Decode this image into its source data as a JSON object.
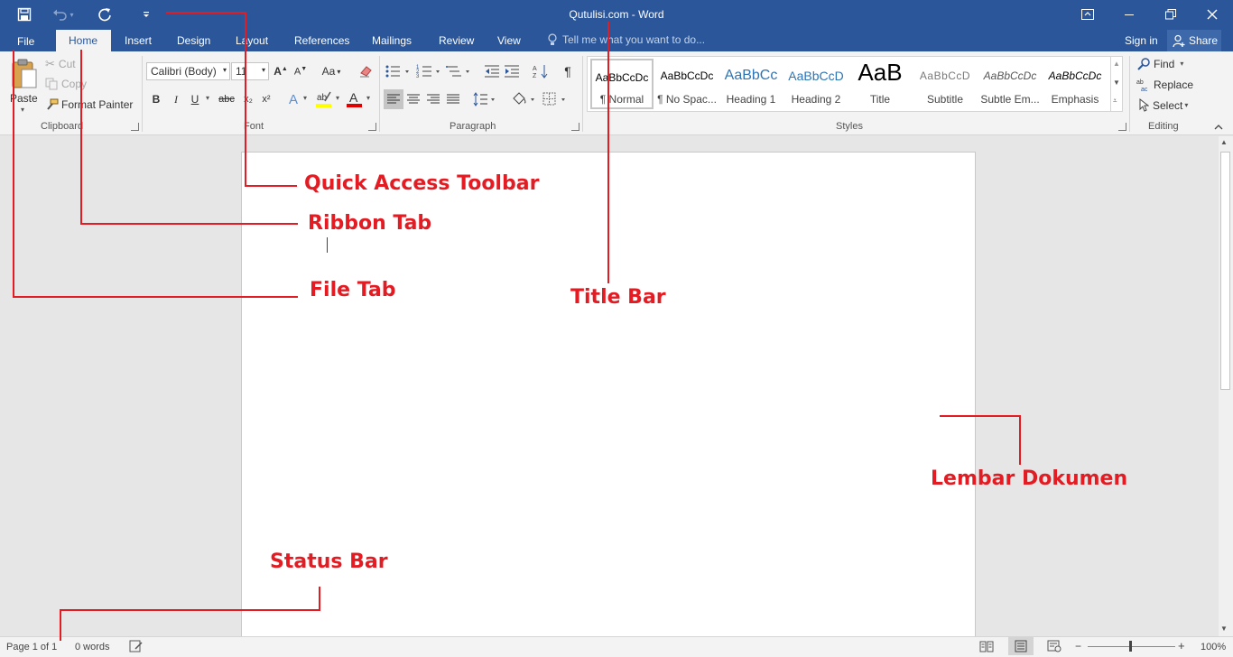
{
  "window": {
    "title": "Qutulisi.com - Word"
  },
  "quick_access": {
    "icons": [
      "save-icon",
      "undo-icon",
      "redo-icon",
      "customize-qat-icon"
    ]
  },
  "tabs": [
    {
      "label": "File"
    },
    {
      "label": "Home",
      "active": true
    },
    {
      "label": "Insert"
    },
    {
      "label": "Design"
    },
    {
      "label": "Layout"
    },
    {
      "label": "References"
    },
    {
      "label": "Mailings"
    },
    {
      "label": "Review"
    },
    {
      "label": "View"
    }
  ],
  "tell_me": {
    "placeholder": "Tell me what you want to do..."
  },
  "account": {
    "sign_in": "Sign in",
    "share": "Share"
  },
  "clipboard": {
    "label": "Clipboard",
    "paste": "Paste",
    "cut": "Cut",
    "copy": "Copy",
    "format_painter": "Format Painter"
  },
  "font": {
    "label": "Font",
    "family": "Calibri (Body)",
    "size": "11",
    "bold": "B",
    "italic": "I",
    "underline": "U",
    "strikethrough": "abc",
    "subscript": "x₂",
    "superscript": "x²",
    "change_case": "Aa"
  },
  "paragraph": {
    "label": "Paragraph"
  },
  "styles": {
    "label": "Styles",
    "items": [
      {
        "sample": "AaBbCcDc",
        "name": "¶ Normal"
      },
      {
        "sample": "AaBbCcDc",
        "name": "¶ No Spac..."
      },
      {
        "sample": "AaBbCc",
        "name": "Heading 1"
      },
      {
        "sample": "AaBbCcD",
        "name": "Heading 2"
      },
      {
        "sample": "AaB",
        "name": "Title"
      },
      {
        "sample": "AaBbCcD",
        "name": "Subtitle"
      },
      {
        "sample": "AaBbCcDc",
        "name": "Subtle Em..."
      },
      {
        "sample": "AaBbCcDc",
        "name": "Emphasis"
      }
    ]
  },
  "editing": {
    "label": "Editing",
    "find": "Find",
    "replace": "Replace",
    "select": "Select"
  },
  "status": {
    "page": "Page 1 of 1",
    "words": "0 words",
    "zoom": "100%"
  },
  "annotations": {
    "quick_access": "Quick Access Toolbar",
    "ribbon_tab": "Ribbon Tab",
    "file_tab": "File Tab",
    "title_bar": "Title Bar",
    "document": "Lembar Dokumen",
    "status_bar": "Status Bar"
  },
  "colors": {
    "title_bar": "#2b579a",
    "ribbon": "#f3f3f3",
    "annotation": "#e31c23",
    "highlight": "#ffff00",
    "font_color": "#e00000"
  }
}
